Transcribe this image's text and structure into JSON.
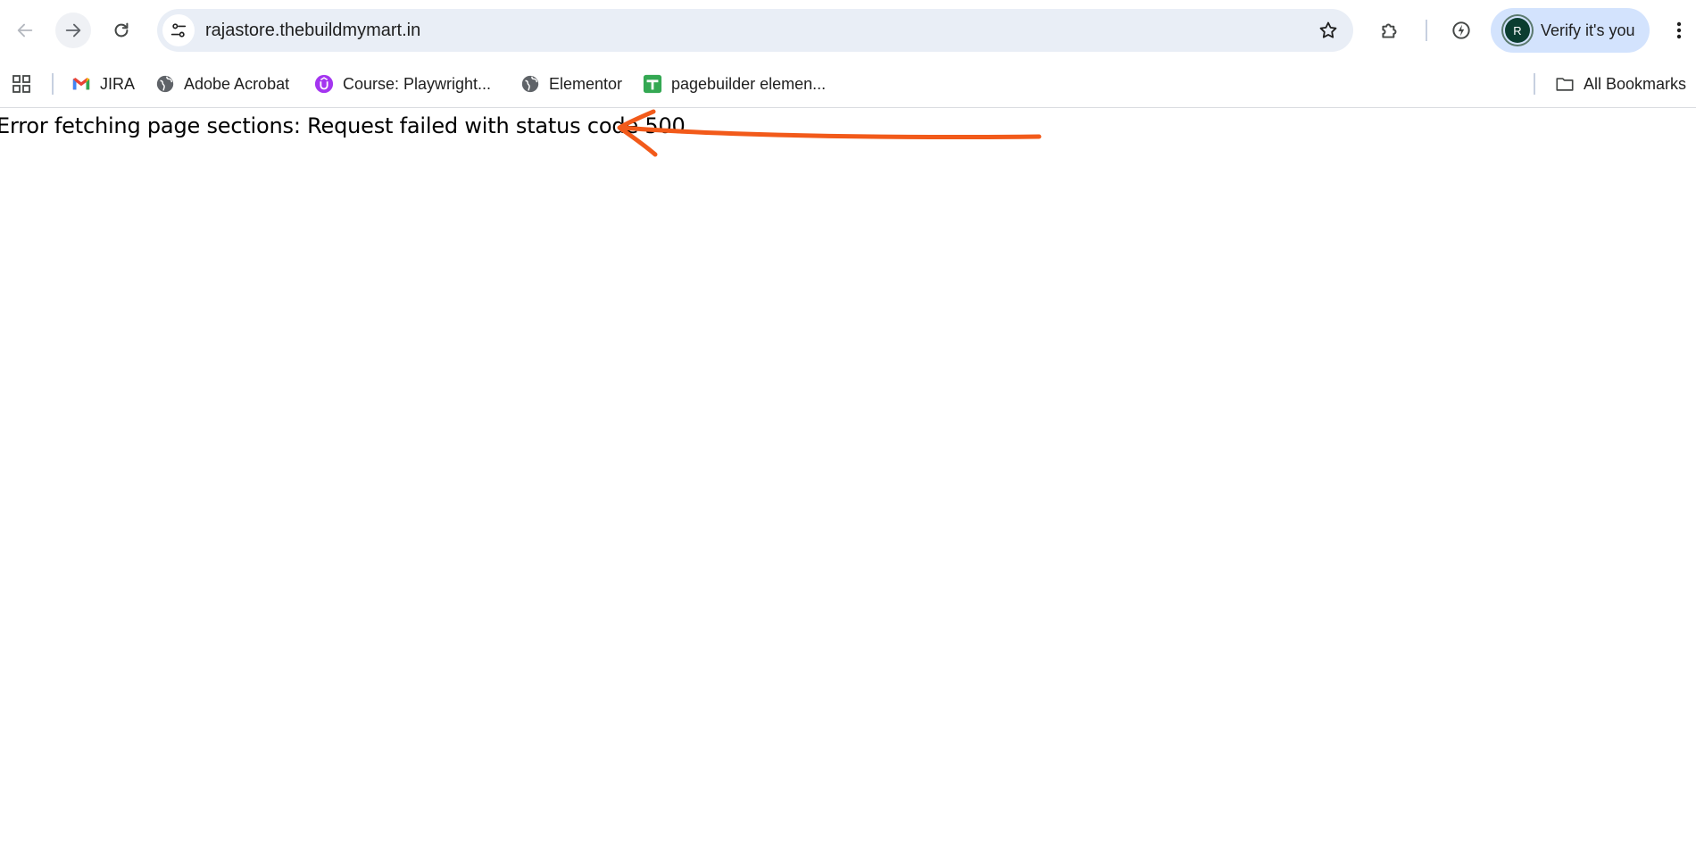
{
  "browser": {
    "url": "rajastore.thebuildmymart.in",
    "profile": {
      "initial": "R",
      "label": "Verify it's you"
    }
  },
  "bookmarks": {
    "items": [
      {
        "label": "JIRA",
        "icon": "gmail-icon"
      },
      {
        "label": "Adobe Acrobat",
        "icon": "globe-icon"
      },
      {
        "label": "Course: Playwright...",
        "icon": "udemy-icon"
      },
      {
        "label": "Elementor",
        "icon": "globe-icon"
      },
      {
        "label": "pagebuilder elemen...",
        "icon": "sheets-icon"
      }
    ],
    "all_bookmarks_label": "All Bookmarks"
  },
  "page": {
    "error_message": "Error fetching page sections: Request failed with status code 500"
  },
  "colors": {
    "annotation_arrow": "#f25a1a",
    "omnibox_bg": "#e9eef6",
    "verify_pill_bg": "#d3e3fd"
  }
}
